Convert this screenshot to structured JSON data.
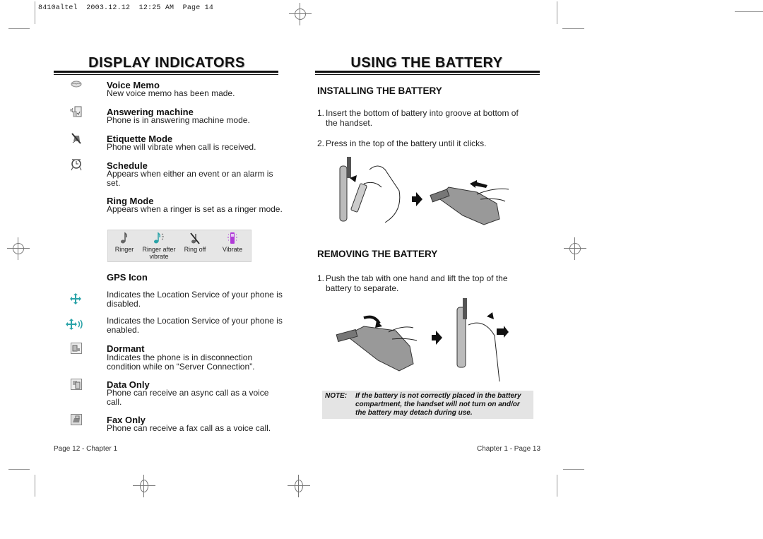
{
  "print_slug": "8410altel  2003.12.12  12:25 AM  Page 14",
  "left_page": {
    "title": "DISPLAY INDICATORS",
    "indicators": [
      {
        "icon": "voice-memo-icon",
        "title": "Voice Memo",
        "desc": "New voice memo has been made."
      },
      {
        "icon": "answering-machine-icon",
        "title": "Answering machine",
        "desc": "Phone is in answering machine mode."
      },
      {
        "icon": "etiquette-mode-icon",
        "title": "Etiquette Mode",
        "desc": "Phone will vibrate when call is received."
      },
      {
        "icon": "alarm-clock-icon",
        "title": "Schedule",
        "desc": "Appears when either an event or an alarm is set."
      },
      {
        "icon": "",
        "title": "Ring Mode",
        "desc": "Appears when a ringer is set as a ringer mode."
      }
    ],
    "ring_modes": [
      {
        "icon": "ringer-icon",
        "label": "Ringer"
      },
      {
        "icon": "ringer-after-vibrate-icon",
        "label": "Ringer after vibrate"
      },
      {
        "icon": "ring-off-icon",
        "label": "Ring off"
      },
      {
        "icon": "vibrate-icon",
        "label": "Vibrate"
      }
    ],
    "gps": {
      "title": "GPS Icon",
      "disabled_desc": "Indicates the Location Service of your phone is disabled.",
      "enabled_desc": "Indicates the Location Service of your phone is enabled."
    },
    "more_indicators": [
      {
        "icon": "dormant-icon",
        "title": "Dormant",
        "desc": "Indicates the phone is in disconnection condition while on “Server Connection”."
      },
      {
        "icon": "data-only-icon",
        "title": "Data Only",
        "desc": "Phone can receive an async call as a voice call."
      },
      {
        "icon": "fax-only-icon",
        "title": "Fax Only",
        "desc": "Phone can receive a fax call as a voice call."
      }
    ],
    "footer": "Page 12 - Chapter 1"
  },
  "right_page": {
    "title": "USING THE BATTERY",
    "installing": {
      "heading": "INSTALLING THE BATTERY",
      "steps": [
        {
          "num": "1.",
          "text": "Insert the bottom of battery into groove at bottom of",
          "cont": "the handset."
        },
        {
          "num": "2.",
          "text": "Press in the top of the battery until it clicks.",
          "cont": ""
        }
      ]
    },
    "removing": {
      "heading": "REMOVING THE BATTERY",
      "steps": [
        {
          "num": "1.",
          "text": "Push the tab with one hand and lift the top of the",
          "cont": "battery to separate."
        }
      ]
    },
    "note": {
      "label": "NOTE:",
      "text": "If the battery is not correctly placed in the battery compartment, the handset will not turn on and/or the battery may detach during use."
    },
    "footer": "Chapter 1 - Page 13"
  },
  "colors": {
    "gps_teal": "#2aa3a8",
    "vibrate_purple": "#b03ad8",
    "note_bg": "#e4e4e4",
    "ring_box_bg": "#e6e6e6"
  }
}
